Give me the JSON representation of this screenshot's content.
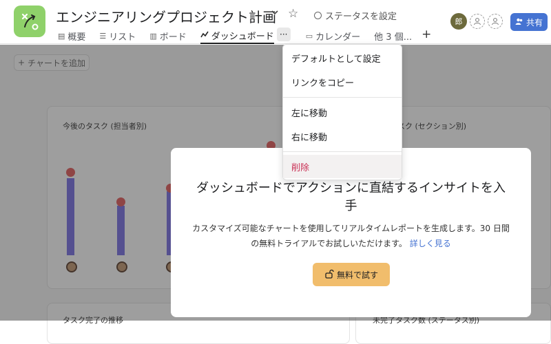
{
  "project": {
    "title": "エンジニアリングプロジェクト計画",
    "status_label": "ステータスを設定"
  },
  "tabs": [
    {
      "icon": "overview-icon",
      "label": "概要"
    },
    {
      "icon": "list-icon",
      "label": "リスト"
    },
    {
      "icon": "board-icon",
      "label": "ボード"
    },
    {
      "icon": "dashboard-icon",
      "label": "ダッシュボード"
    },
    {
      "icon": "calendar-icon",
      "label": "カレンダー"
    },
    {
      "icon": "",
      "label": "他 3 個..."
    }
  ],
  "header": {
    "avatar_initial": "郎",
    "share_label": "共有"
  },
  "dashboard": {
    "add_chart_label": "チャートを追加",
    "card1_title": "今後のタスク (担当者別)",
    "card2_title": "スク (セクション別)",
    "card3_title": "タスク完了の推移",
    "card4_title": "未完了タスク数 (ステータス別)"
  },
  "menu": {
    "items": [
      "デフォルトとして設定",
      "リンクをコピー",
      "左に移動",
      "右に移動",
      "削除"
    ]
  },
  "modal": {
    "title": "ダッシュボードでアクションに直結するインサイトを入手",
    "body": "カスタマイズ可能なチャートを使用してリアルタイムレポートを生成します。30 日間の無料トライアルでお試しいただけます。",
    "link": "詳しく見る",
    "button": "無料で試す"
  },
  "colors": {
    "share_button": "#4573d2",
    "trial_button": "#f1bd6c",
    "bar": "#7b72e6",
    "delete": "#c92f54",
    "app_icon": "#8fd16a"
  }
}
